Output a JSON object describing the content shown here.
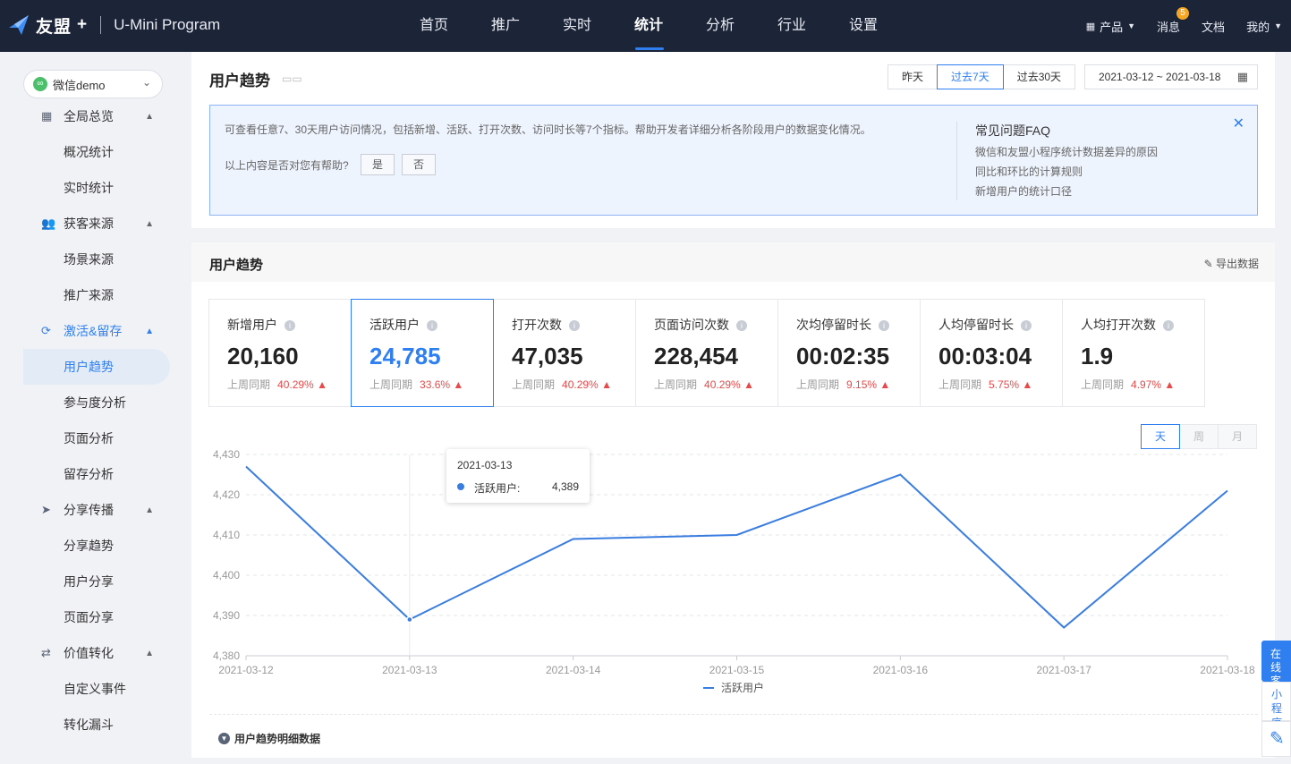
{
  "topbar": {
    "brand": "友盟",
    "brand_plus": "+",
    "product": "U-Mini Program",
    "nav": [
      "首页",
      "推广",
      "实时",
      "统计",
      "分析",
      "行业",
      "设置"
    ],
    "nav_active": "统计",
    "products_label": "产品",
    "messages_label": "消息",
    "messages_badge": "5",
    "docs_label": "文档",
    "mine_label": "我的"
  },
  "sidebar": {
    "app_name": "微信demo",
    "groups": [
      {
        "label": "全局总览",
        "icon": "grid-icon",
        "items": [
          "概况统计",
          "实时统计"
        ]
      },
      {
        "label": "获客来源",
        "icon": "users-icon",
        "items": [
          "场景来源",
          "推广来源"
        ]
      },
      {
        "label": "激活&留存",
        "icon": "refresh-search-icon",
        "items": [
          "用户趋势",
          "参与度分析",
          "页面分析",
          "留存分析"
        ]
      },
      {
        "label": "分享传播",
        "icon": "paper-plane-icon",
        "items": [
          "分享趋势",
          "用户分享",
          "页面分享"
        ]
      },
      {
        "label": "价值转化",
        "icon": "transfer-icon",
        "items": [
          "自定义事件",
          "转化漏斗"
        ]
      }
    ],
    "active_group": "激活&留存",
    "active_item": "用户趋势"
  },
  "header_card": {
    "title": "用户趋势",
    "periods": [
      "昨天",
      "过去7天",
      "过去30天"
    ],
    "period_selected": "过去7天",
    "date_range": "2021-03-12 ~ 2021-03-18",
    "info_text": "可查看任意7、30天用户访问情况，包括新增、活跃、打开次数、访问时长等7个指标。帮助开发者详细分析各阶段用户的数据变化情况。",
    "help_question": "以上内容是否对您有帮助?",
    "help_yes": "是",
    "help_no": "否",
    "faq_title": "常见问题FAQ",
    "faq_links": [
      "微信和友盟小程序统计数据差异的原因",
      "同比和环比的计算规则",
      "新增用户的统计口径"
    ]
  },
  "trend_card": {
    "title": "用户趋势",
    "export_label": "导出数据",
    "compare_label": "上周同期",
    "metrics": [
      {
        "label": "新增用户",
        "value": "20,160",
        "change": "40.29%"
      },
      {
        "label": "活跃用户",
        "value": "24,785",
        "change": "33.6%"
      },
      {
        "label": "打开次数",
        "value": "47,035",
        "change": "40.29%"
      },
      {
        "label": "页面访问次数",
        "value": "228,454",
        "change": "40.29%"
      },
      {
        "label": "次均停留时长",
        "value": "00:02:35",
        "change": "9.15%"
      },
      {
        "label": "人均停留时长",
        "value": "00:03:04",
        "change": "5.75%"
      },
      {
        "label": "人均打开次数",
        "value": "1.9",
        "change": "4.97%"
      }
    ],
    "selected_metric": "活跃用户",
    "granularity": [
      "天",
      "周",
      "月"
    ],
    "granularity_selected": "天",
    "tooltip": {
      "date": "2021-03-13",
      "series": "活跃用户:",
      "value": "4,389"
    },
    "detail_label": "用户趋势明细数据"
  },
  "chart_data": {
    "type": "line",
    "x": [
      "2021-03-12",
      "2021-03-13",
      "2021-03-14",
      "2021-03-15",
      "2021-03-16",
      "2021-03-17",
      "2021-03-18"
    ],
    "series": [
      {
        "name": "活跃用户",
        "values": [
          4427,
          4389,
          4409,
          4410,
          4425,
          4387,
          4421
        ]
      }
    ],
    "yticks": [
      "4,380",
      "4,390",
      "4,400",
      "4,410",
      "4,420",
      "4,430"
    ],
    "ylim": [
      4380,
      4430
    ],
    "grid": true,
    "legend": "bottom-center",
    "color": "#3a7de0"
  },
  "float_panel": {
    "cs_label": "在线客服",
    "group_label": "小程序群"
  },
  "colors": {
    "accent": "#2f7ff0",
    "nav_bg": "#1c2438",
    "up": "#e84a4a",
    "line": "#3a7de0"
  }
}
